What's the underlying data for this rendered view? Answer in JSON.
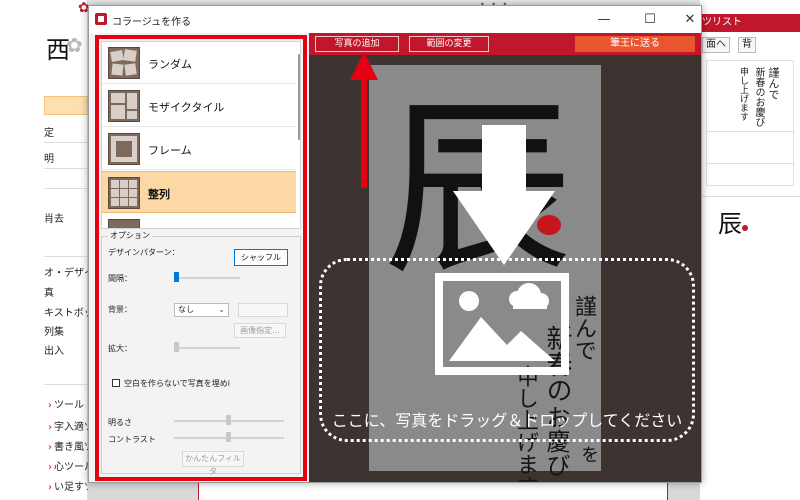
{
  "window": {
    "title": "コラージュを作る",
    "controls": [
      "—",
      "☐",
      "✕"
    ]
  },
  "pattern_list": {
    "items": [
      {
        "label": "ランダム",
        "selected": false
      },
      {
        "label": "モザイクタイル",
        "selected": false
      },
      {
        "label": "フレーム",
        "selected": false
      },
      {
        "label": "整列",
        "selected": true
      }
    ]
  },
  "options": {
    "group_title": "オプション",
    "design_pattern_label": "デザインパターン：",
    "shuffle_label": "シャッフル",
    "spacing_label": "間隔：",
    "spacing_value": 0,
    "background_label": "背景：",
    "background_value": "なし",
    "image_button_label": "画像指定...",
    "zoom_label": "拡大：",
    "fill_checkbox_label": "空白を作らないで写真を埋めi",
    "fill_checked": false,
    "brightness_label": "明るさ",
    "contrast_label": "コントラスト",
    "filter_button_label": "かんたんフィルタ"
  },
  "toolbar": {
    "add_photo_label": "写真の追加",
    "change_range_label": "範囲の変更",
    "send_label": "筆王に送る"
  },
  "canvas": {
    "drop_text": "ここに、写真をドラッグ＆ドロップしてください",
    "photo_glyph": "辰",
    "calligraphy_1": "謹んで",
    "calligraphy_2": "新春の",
    "calligraphy_3": "お慶び",
    "calligraphy_4": "を",
    "calligraphy_5": "申し上げます"
  },
  "background_app": {
    "left_items": [
      "定",
      "明",
      "肖去",
      "オ・デザイ",
      "真",
      "キストボック",
      "列集",
      "出入"
    ],
    "tools": [
      "ツール",
      "字入適ツー",
      "書き風ツー",
      "心ツール",
      "い足すツー"
    ],
    "right_tab": "ツリスト",
    "right_buttons": [
      "面へ",
      "背"
    ],
    "right_glyph": "辰",
    "left_glyph": "西",
    "card_text": [
      "謹んで",
      "新春のお慶び",
      "申し上げます"
    ]
  },
  "colors": {
    "brand_red": "#c0172c",
    "highlight_red": "#e60012",
    "selected_row": "#fbd8a4",
    "canvas_bg": "#3d3331",
    "primary_button": "#e8552f"
  },
  "icons": [
    "app-icon",
    "arrow-down-icon",
    "image-icon",
    "arrow-up-icon",
    "gear-icon",
    "flower-icon"
  ]
}
